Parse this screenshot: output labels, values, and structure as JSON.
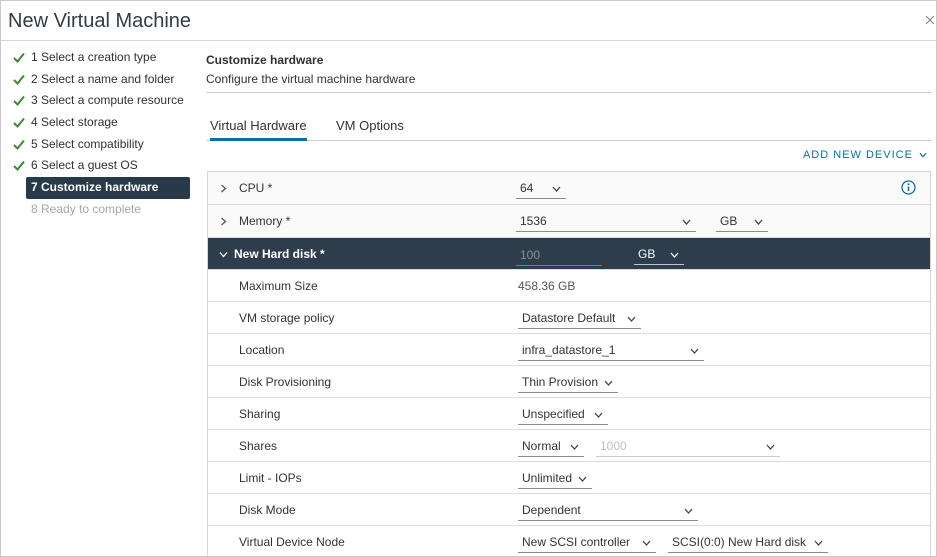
{
  "window": {
    "title": "New Virtual Machine"
  },
  "steps": [
    {
      "label": "1 Select a creation type",
      "state": "done"
    },
    {
      "label": "2 Select a name and folder",
      "state": "done"
    },
    {
      "label": "3 Select a compute resource",
      "state": "done"
    },
    {
      "label": "4 Select storage",
      "state": "done"
    },
    {
      "label": "5 Select compatibility",
      "state": "done"
    },
    {
      "label": "6 Select a guest OS",
      "state": "done"
    },
    {
      "label": "7 Customize hardware",
      "state": "active"
    },
    {
      "label": "8 Ready to complete",
      "state": "disabled"
    }
  ],
  "main": {
    "title": "Customize hardware",
    "subtitle": "Configure the virtual machine hardware",
    "tabs": [
      {
        "label": "Virtual Hardware",
        "active": true
      },
      {
        "label": "VM Options",
        "active": false
      }
    ],
    "add_device": "ADD NEW DEVICE"
  },
  "hardware": {
    "cpu": {
      "label": "CPU *",
      "value": "64"
    },
    "memory": {
      "label": "Memory *",
      "value": "1536",
      "unit": "GB"
    },
    "disk": {
      "label": "New Hard disk *",
      "size": "100",
      "unit": "GB",
      "rows": {
        "max_size": {
          "label": "Maximum Size",
          "value": "458.36 GB"
        },
        "policy": {
          "label": "VM storage policy",
          "value": "Datastore Default"
        },
        "location": {
          "label": "Location",
          "value": "infra_datastore_1"
        },
        "provisioning": {
          "label": "Disk Provisioning",
          "value": "Thin Provision"
        },
        "sharing": {
          "label": "Sharing",
          "value": "Unspecified"
        },
        "shares": {
          "label": "Shares",
          "value": "Normal",
          "amount": "1000"
        },
        "iops": {
          "label": "Limit - IOPs",
          "value": "Unlimited"
        },
        "mode": {
          "label": "Disk Mode",
          "value": "Dependent"
        },
        "node": {
          "label": "Virtual Device Node",
          "controller": "New SCSI controller",
          "slot": "SCSI(0:0) New Hard disk"
        }
      }
    }
  },
  "colors": {
    "accent": "#0072a3",
    "selected_row": "#2e3d4c",
    "check": "#3c8d2a",
    "active_step": "#28394a"
  },
  "icons": [
    "check-icon",
    "close-icon",
    "caret-right-icon",
    "caret-down-icon",
    "chevron-down-icon",
    "info-icon"
  ]
}
